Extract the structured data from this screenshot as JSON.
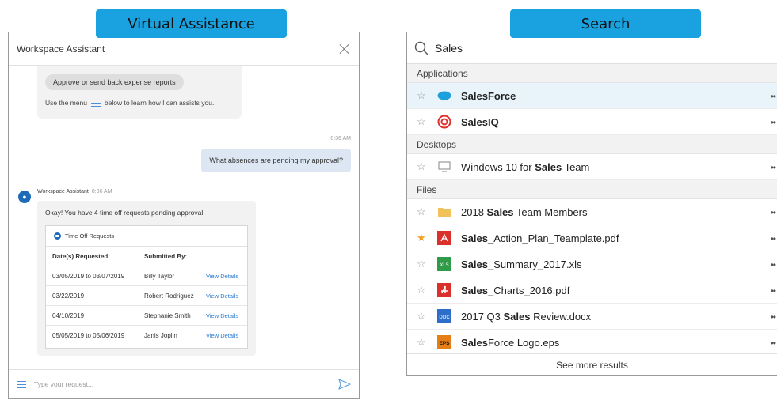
{
  "banners": {
    "left": "Virtual Assistance",
    "right": "Search"
  },
  "chat": {
    "title": "Workspace Assistant",
    "top_chip": "Approve or send back expense reports",
    "help_prefix": "Use the menu",
    "help_suffix": "below to learn how I can assists you.",
    "user_time": "8:36 AM",
    "user_message": "What absences are pending my approval?",
    "bot_name": "Workspace Assistant",
    "bot_time": "8:36 AM",
    "bot_message": "Okay! You have 4 time off requests pending approval.",
    "card_title": "Time Off Requests",
    "table_headers": [
      "Date(s) Requested:",
      "Submitted By:"
    ],
    "rows": [
      {
        "dates": "03/05/2019 to 03/07/2019",
        "by": "Billy Taylor",
        "link": "View Details"
      },
      {
        "dates": "03/22/2019",
        "by": "Robert Rodriguez",
        "link": "View Details"
      },
      {
        "dates": "04/10/2019",
        "by": "Stephanie Smith",
        "link": "View Details"
      },
      {
        "dates": "05/05/2019 to 05/06/2019",
        "by": "Janis Joplin",
        "link": "View Details"
      }
    ],
    "input_placeholder": "Type your request..."
  },
  "search": {
    "query": "Sales",
    "sections": {
      "applications": "Applications",
      "desktops": "Desktops",
      "files": "Files"
    },
    "results": {
      "app1": {
        "bold": "Sales",
        "rest": "Force"
      },
      "app2": {
        "bold": "Sales",
        "rest": "IQ"
      },
      "desk1": {
        "pre": "Windows 10 for ",
        "bold": "Sales",
        "rest": " Team"
      },
      "file1": {
        "pre": "2018 ",
        "bold": "Sales",
        "rest": " Team Members"
      },
      "file2": {
        "bold": "Sales",
        "rest": "_Action_Plan_Teamplate.pdf"
      },
      "file3": {
        "bold": "Sales",
        "rest": "_Summary_2017.xls"
      },
      "file4": {
        "bold": "Sales",
        "rest": "_Charts_2016.pdf"
      },
      "file5": {
        "pre": "2017 Q3 ",
        "bold": "Sales",
        "rest": " Review.docx"
      },
      "file6": {
        "bold": "Sales",
        "rest": "Force Logo.eps"
      }
    },
    "more_glyph": "••",
    "see_more": "See more results",
    "file_badges": {
      "xls": "XLS",
      "doc": "DOC",
      "eps": "EPS"
    }
  },
  "colors": {
    "accent": "#1aa1e0",
    "selected_row": "#e8f4fa",
    "link": "#2a7bd0",
    "favorite": "#f4a020"
  }
}
